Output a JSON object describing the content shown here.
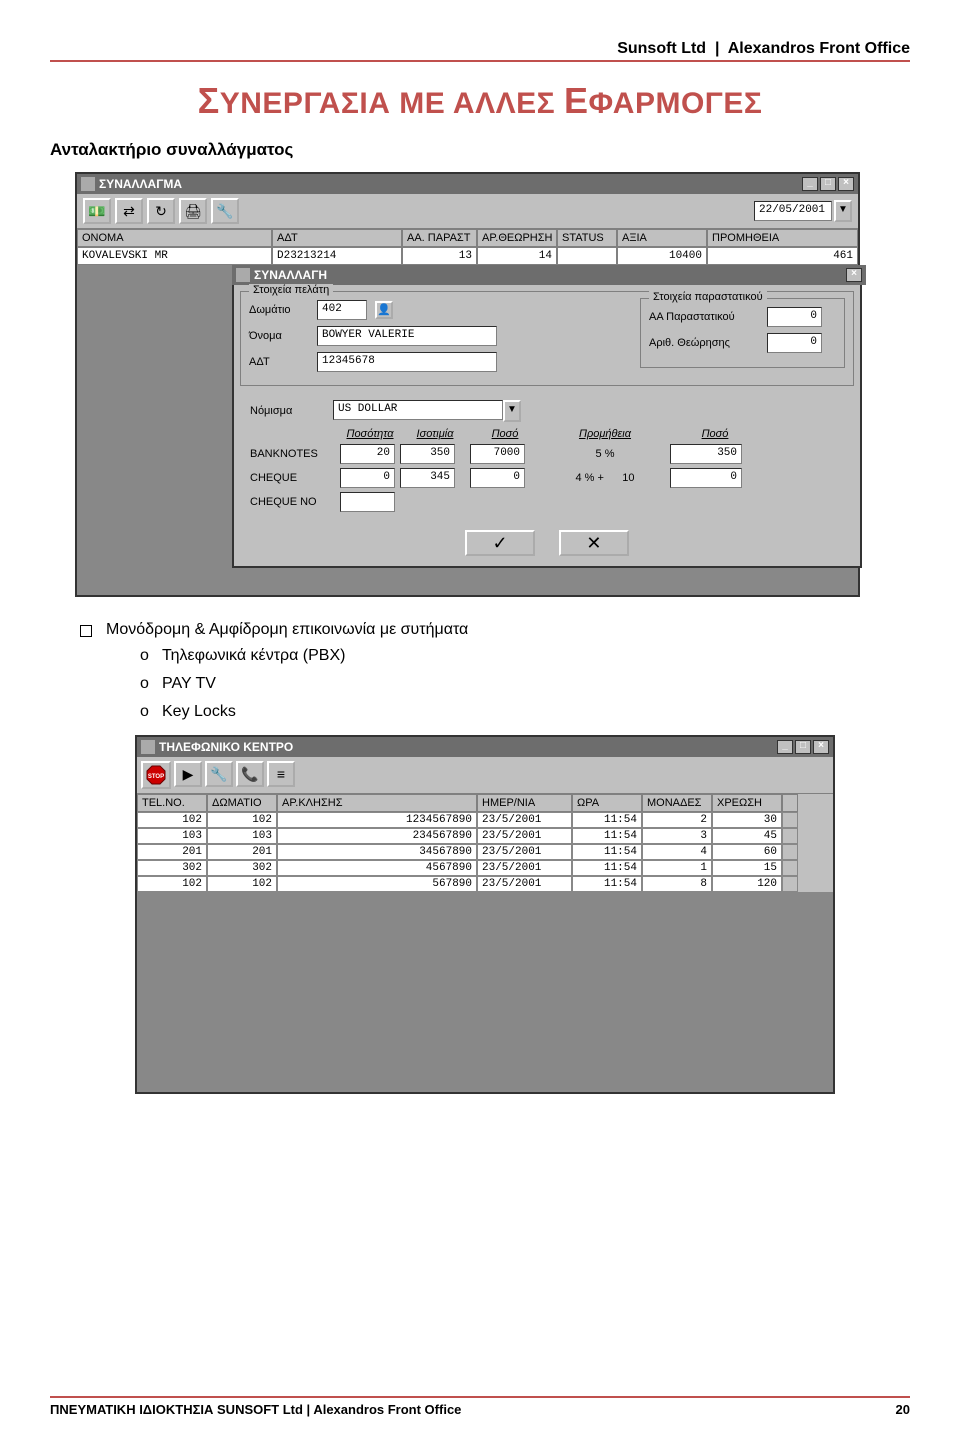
{
  "header": {
    "company": "Sunsoft Ltd",
    "product": "Alexandros Front Office"
  },
  "title": {
    "word1_first": "Σ",
    "word1_rest": "ΥΝΕΡΓΑΣΙΑ ΜΕ ΑΛΛΕΣ ",
    "word2_first": "Ε",
    "word2_rest": "ΦΑΡΜΟΓΕΣ"
  },
  "subtitle": "Ανταλακτήριο συναλλάγματος",
  "win1": {
    "title": "ΣΥΝΑΛΛΑΓΜΑ",
    "date": "22/05/2001",
    "columns": [
      "ΟΝΟΜΑ",
      "ΑΔΤ",
      "ΑΑ. ΠΑΡΑΣΤ",
      "ΑΡ.ΘΕΩΡΗΣΗ",
      "STATUS",
      "ΑΞΙΑ",
      "ΠΡΟΜΗΘΕΙΑ"
    ],
    "row": {
      "name": "KOVALEVSKI MR",
      "adt": "D23213214",
      "parast": "13",
      "theor": "14",
      "status": "",
      "axia": "10400",
      "prom": "461"
    }
  },
  "dlg": {
    "title": "ΣΥΝΑΛΛΑΓΗ",
    "fs_customer": "Στοιχεία πελάτη",
    "room_lbl": "Δωμάτιο",
    "room": "402",
    "name_lbl": "Όνομα",
    "name": "BOWYER VALERIE",
    "adt_lbl": "ΑΔΤ",
    "adt": "12345678",
    "fs_doc": "Στοιχεία παραστατικού",
    "doc_aa_lbl": "ΑΑ Παραστατικού",
    "doc_aa": "0",
    "doc_theor_lbl": "Αριθ. Θεώρησης",
    "doc_theor": "0",
    "currency_lbl": "Νόμισμα",
    "currency": "US DOLLAR",
    "cols": {
      "qty": "Ποσότητα",
      "rate": "Ισοτιμία",
      "amount": "Ποσό",
      "comm": "Προμήθεια",
      "final": "Ποσό"
    },
    "banknotes": {
      "label": "BANKNOTES",
      "qty": "20",
      "rate": "350",
      "amount": "7000",
      "comm": "5 %",
      "final": "350"
    },
    "cheque": {
      "label": "CHEQUE",
      "qty": "0",
      "rate": "345",
      "amount": "0",
      "comm_pct": "4 % +",
      "comm_flat": "10",
      "final": "0"
    },
    "chequeno": {
      "label": "CHEQUE NO",
      "value": ""
    },
    "ok": "✓",
    "cancel": "✕"
  },
  "bullets": {
    "main": "Μονόδρομη & Αμφίδρομη επικοινωνία με συτήματα",
    "sub": [
      "Τηλεφωνικά κέντρα  (PBX)",
      "PAY TV",
      "Key Locks"
    ]
  },
  "win2": {
    "title": "ΤΗΛΕΦΩΝΙΚΟ ΚΕΝΤΡΟ",
    "stop": "STOP",
    "columns": [
      "TEL.NO.",
      "ΔΩΜΑΤΙΟ",
      "ΑΡ.ΚΛΗΣΗΣ",
      "ΗΜΕΡ/ΝΙΑ",
      "ΩΡΑ",
      "ΜΟΝΑΔΕΣ",
      "ΧΡΕΩΣΗ"
    ],
    "rows": [
      {
        "tel": "102",
        "room": "102",
        "call": "1234567890",
        "date": "23/5/2001",
        "time": "11:54",
        "units": "2",
        "charge": "30"
      },
      {
        "tel": "103",
        "room": "103",
        "call": "234567890",
        "date": "23/5/2001",
        "time": "11:54",
        "units": "3",
        "charge": "45"
      },
      {
        "tel": "201",
        "room": "201",
        "call": "34567890",
        "date": "23/5/2001",
        "time": "11:54",
        "units": "4",
        "charge": "60"
      },
      {
        "tel": "302",
        "room": "302",
        "call": "4567890",
        "date": "23/5/2001",
        "time": "11:54",
        "units": "1",
        "charge": "15"
      },
      {
        "tel": "102",
        "room": "102",
        "call": "567890",
        "date": "23/5/2001",
        "time": "11:54",
        "units": "8",
        "charge": "120"
      }
    ]
  },
  "footer": {
    "left": "ΠΝΕΥΜΑΤΙΚΗ ΙΔΙΟΚΤΗΣΙΑ  SUNSOFT  Ltd   |   Alexandros Front Office",
    "page": "20"
  }
}
